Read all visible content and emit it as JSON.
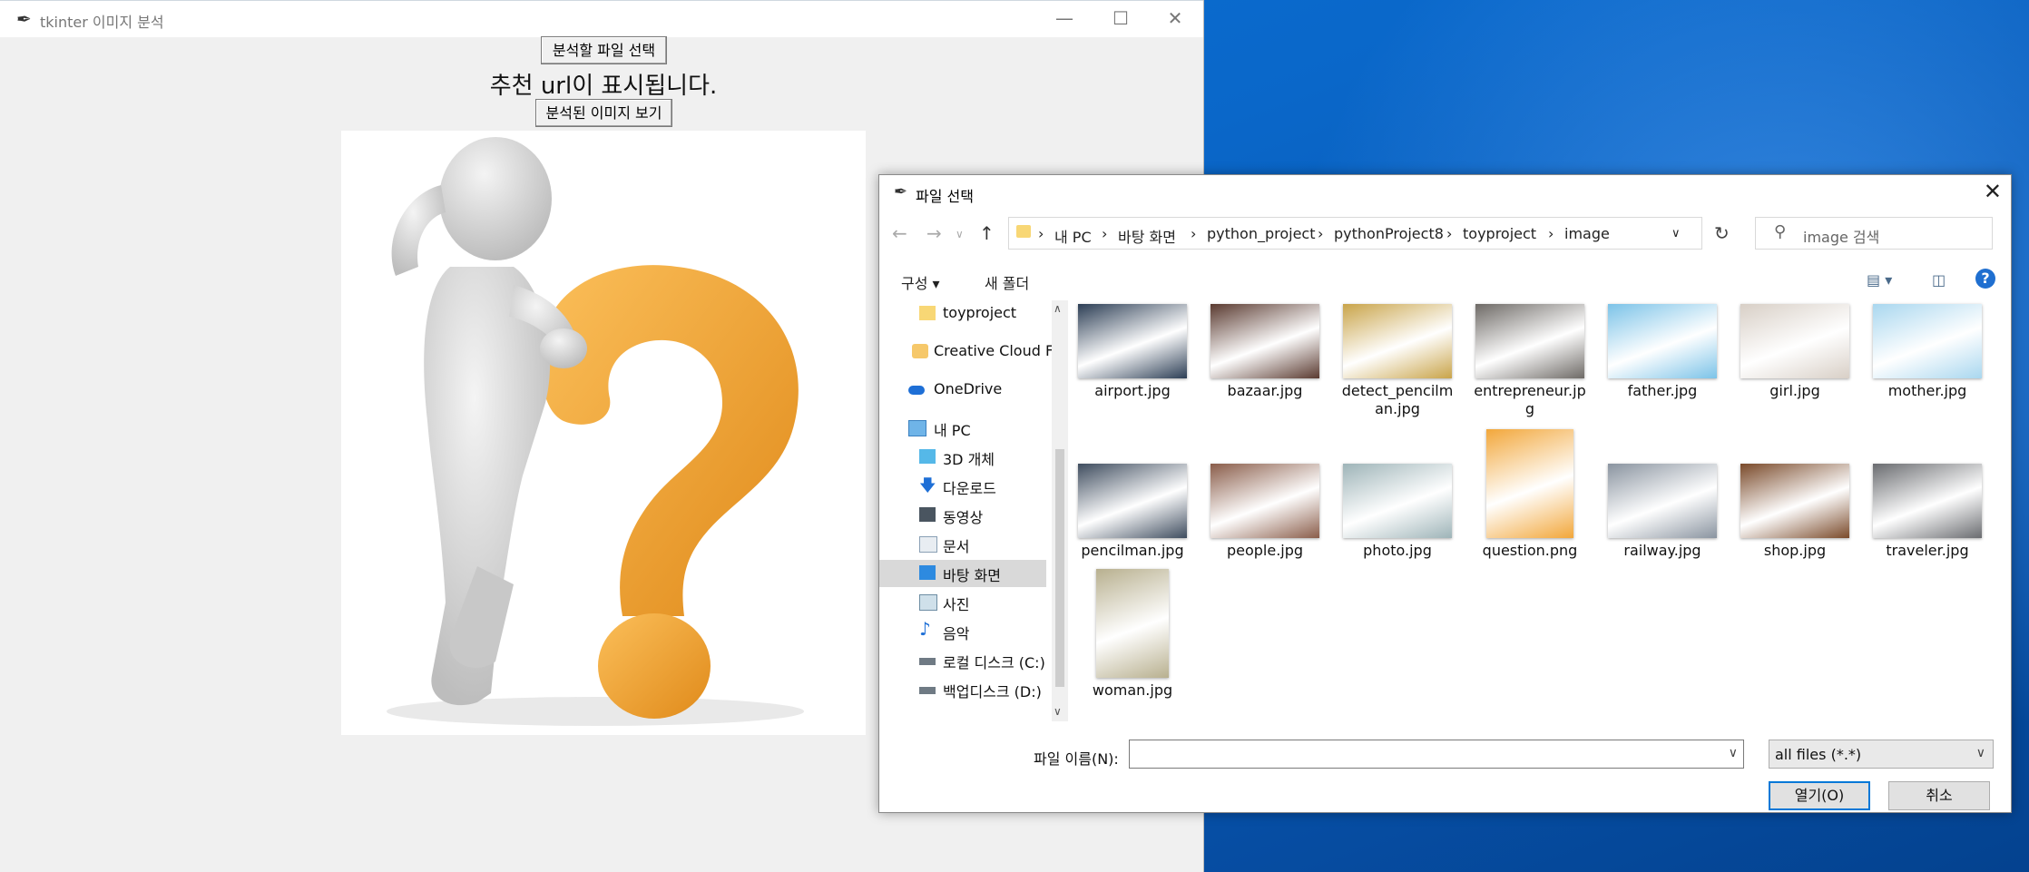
{
  "main_window": {
    "title": "tkinter 이미지 분석",
    "select_button": "분석할 파일 선택",
    "url_label": "추천 url이 표시됩니다.",
    "view_button": "분석된 이미지 보기",
    "image_icon": "question-mark-figure"
  },
  "dialog": {
    "title": "파일 선택",
    "path": [
      "내 PC",
      "바탕 화면",
      "python_project",
      "pythonProject8",
      "toyproject",
      "image"
    ],
    "search_placeholder": "image 검색",
    "toolbar": {
      "organize": "구성 ▾",
      "new_folder": "새 폴더"
    },
    "sidebar": [
      {
        "label": "toyproject",
        "icon": "folder-icon"
      },
      {
        "label": "Creative Cloud Fil",
        "icon": "creative-cloud-icon"
      },
      {
        "label": "OneDrive",
        "icon": "cloud-icon"
      },
      {
        "label": "내 PC",
        "icon": "pc-icon"
      },
      {
        "label": "3D 개체",
        "icon": "cube-icon"
      },
      {
        "label": "다운로드",
        "icon": "download-icon"
      },
      {
        "label": "동영상",
        "icon": "video-icon"
      },
      {
        "label": "문서",
        "icon": "document-icon"
      },
      {
        "label": "바탕 화면",
        "icon": "desktop-icon"
      },
      {
        "label": "사진",
        "icon": "picture-icon"
      },
      {
        "label": "음악",
        "icon": "music-icon"
      },
      {
        "label": "로컬 디스크 (C:)",
        "icon": "drive-icon"
      },
      {
        "label": "백업디스크 (D:)",
        "icon": "drive-icon"
      }
    ],
    "files": [
      {
        "name": "airport.jpg",
        "color": "#2c3e55"
      },
      {
        "name": "bazaar.jpg",
        "color": "#5a3a30"
      },
      {
        "name": "detect_pencilman.jpg",
        "color": "#c9a44a"
      },
      {
        "name": "entrepreneur.jpg",
        "color": "#6e6a66"
      },
      {
        "name": "father.jpg",
        "color": "#7cc3e8"
      },
      {
        "name": "girl.jpg",
        "color": "#d8cfc6"
      },
      {
        "name": "mother.jpg",
        "color": "#a9d7ef"
      },
      {
        "name": "pencilman.jpg",
        "color": "#3f4d5f"
      },
      {
        "name": "people.jpg",
        "color": "#8a5d4a"
      },
      {
        "name": "photo.jpg",
        "color": "#9eb4b8"
      },
      {
        "name": "question.png",
        "color": "#f2a73b"
      },
      {
        "name": "railway.jpg",
        "color": "#8a94a0"
      },
      {
        "name": "shop.jpg",
        "color": "#7a4a2a"
      },
      {
        "name": "traveler.jpg",
        "color": "#6a6c70"
      },
      {
        "name": "woman.jpg",
        "color": "#b8b08f"
      }
    ],
    "filename_label": "파일 이름(N):",
    "filename_value": "",
    "filetype": "all files (*.*)",
    "open_button": "열기(O)",
    "cancel_button": "취소"
  }
}
